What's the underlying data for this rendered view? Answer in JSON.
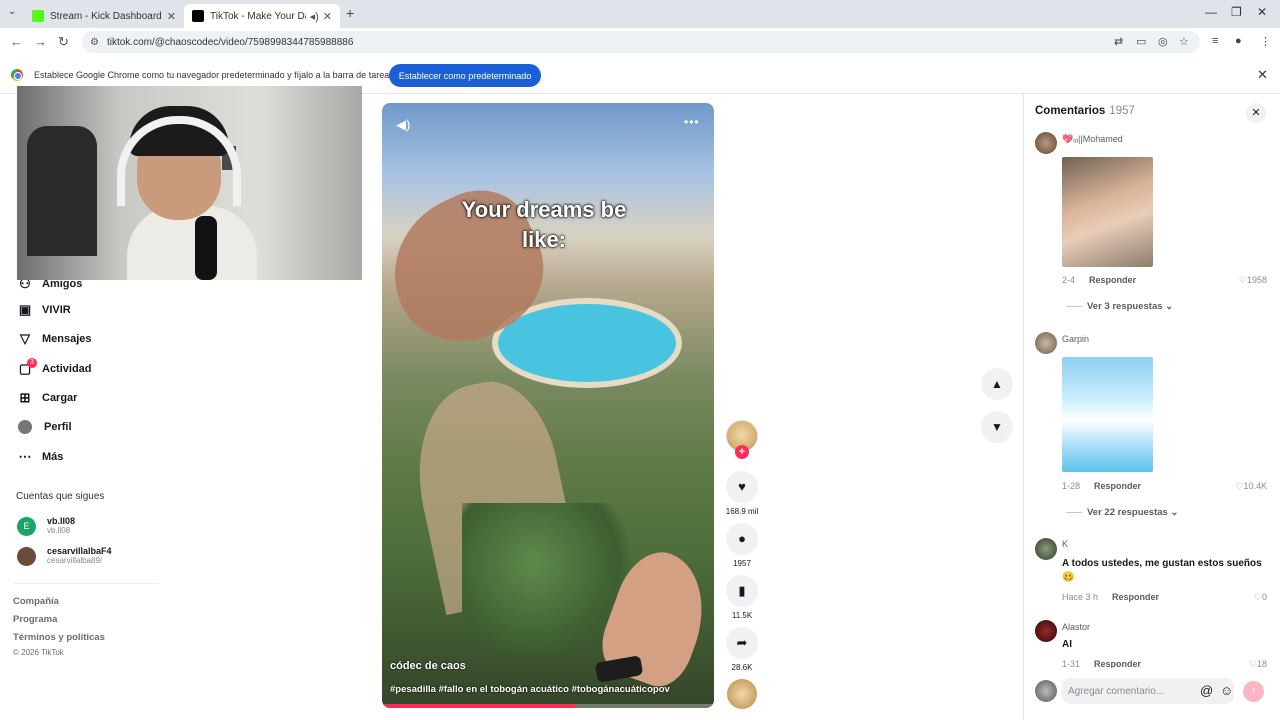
{
  "browser": {
    "tabs": [
      {
        "title": "Stream - Kick Dashboard",
        "favicon_color": "#53fc18"
      },
      {
        "title": "TikTok - Make Your Day",
        "favicon_color": "#000000"
      }
    ],
    "new_tab": "+",
    "url": "tiktok.com/@chaoscodec/video/7598998344785988886",
    "infobar": {
      "message": "Establece Google Chrome como tu navegador predeterminado y fíjalo a la barra de tareas",
      "button": "Establecer como predeterminado"
    }
  },
  "nav": {
    "items": [
      {
        "label": "Amigos",
        "icon": "friends-icon"
      },
      {
        "label": "VIVIR",
        "icon": "live-icon"
      },
      {
        "label": "Mensajes",
        "icon": "messages-icon"
      },
      {
        "label": "Actividad",
        "icon": "activity-icon",
        "badge": "3"
      },
      {
        "label": "Cargar",
        "icon": "upload-icon"
      },
      {
        "label": "Perfil",
        "icon": "profile-icon"
      },
      {
        "label": "Más",
        "icon": "more-icon"
      }
    ],
    "following_title": "Cuentas que sigues",
    "following": [
      {
        "name": "vb.ll08",
        "username": "vb.ll08",
        "initial": "E",
        "color": "#1aa36a"
      },
      {
        "name": "cesarvillalbaF4",
        "username": "cesarvillalba89/",
        "initial": "",
        "color": "#6b4b3a"
      }
    ],
    "footer": [
      "Compañía",
      "Programa",
      "Términos y políticas"
    ],
    "copyright": "© 2026 TikTok"
  },
  "video": {
    "caption": "Your dreams be like:",
    "author": "códec de caos",
    "tags": "#pesadilla #fallo en el tobogán acuático #tobogánacuáticopov",
    "progress": 0.58
  },
  "actions": {
    "likes": "168.9 mil",
    "comments": "1957",
    "saves": "11.5K",
    "shares": "28.6K"
  },
  "comments": {
    "title": "Comentarios",
    "count": "1957",
    "list": [
      {
        "user": "💖ᵢₒ||Mohamed",
        "date": "2-4",
        "reply": "Responder",
        "likes": "1958",
        "view_more": "Ver 3 respuestas"
      },
      {
        "user": "Garpin",
        "date": "1-28",
        "reply": "Responder",
        "likes": "10.4K",
        "view_more": "Ver 22 respuestas"
      },
      {
        "user": "K",
        "text": "A todos ustedes, me gustan estos sueños 🥴",
        "date": "Hace 3 h",
        "reply": "Responder",
        "likes": "0"
      },
      {
        "user": "Alastor",
        "text": "AI",
        "date": "1-31",
        "reply": "Responder",
        "likes": "18"
      }
    ],
    "input_placeholder": "Agregar comentario..."
  }
}
